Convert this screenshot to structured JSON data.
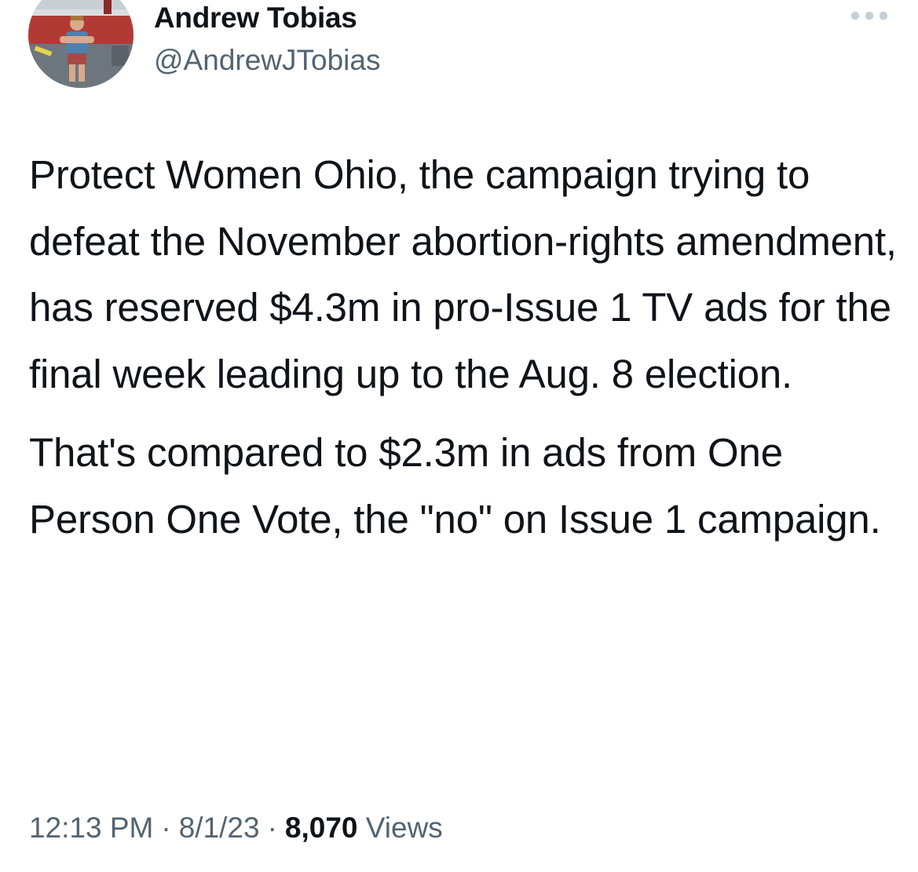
{
  "author": {
    "display_name": "Andrew Tobias",
    "handle": "@AndrewJTobias"
  },
  "tweet": {
    "paragraphs": [
      "Protect Women Ohio, the campaign trying to defeat the November abortion-rights amendment, has reserved $4.3m in pro-Issue 1 TV ads for the final week leading up to the Aug. 8 election.",
      "That's compared to $2.3m in ads from One Person One Vote, the \"no\" on Issue 1 campaign."
    ]
  },
  "meta": {
    "time": "12:13 PM",
    "separator": "·",
    "date": "8/1/23",
    "views_count": "8,070",
    "views_label": "Views"
  },
  "icons": {
    "more": "more-horizontal-icon"
  },
  "colors": {
    "primary_text": "#0f1419",
    "secondary_text": "#536471",
    "background": "#ffffff"
  }
}
